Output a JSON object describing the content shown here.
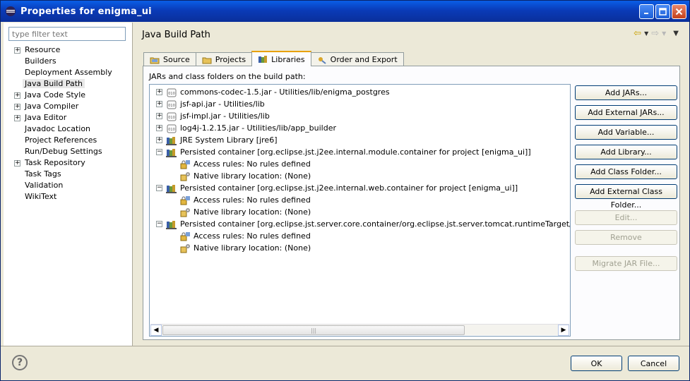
{
  "window": {
    "title": "Properties for enigma_ui"
  },
  "filter": {
    "placeholder": "type filter text"
  },
  "nav": {
    "items": [
      {
        "label": "Resource",
        "expandable": true
      },
      {
        "label": "Builders",
        "expandable": false
      },
      {
        "label": "Deployment Assembly",
        "expandable": false
      },
      {
        "label": "Java Build Path",
        "expandable": false,
        "selected": true
      },
      {
        "label": "Java Code Style",
        "expandable": true
      },
      {
        "label": "Java Compiler",
        "expandable": true
      },
      {
        "label": "Java Editor",
        "expandable": true
      },
      {
        "label": "Javadoc Location",
        "expandable": false
      },
      {
        "label": "Project References",
        "expandable": false
      },
      {
        "label": "Run/Debug Settings",
        "expandable": false
      },
      {
        "label": "Task Repository",
        "expandable": true
      },
      {
        "label": "Task Tags",
        "expandable": false
      },
      {
        "label": "Validation",
        "expandable": false
      },
      {
        "label": "WikiText",
        "expandable": false
      }
    ]
  },
  "main": {
    "title": "Java Build Path",
    "tabs": [
      {
        "label": "Source"
      },
      {
        "label": "Projects"
      },
      {
        "label": "Libraries",
        "active": true
      },
      {
        "label": "Order and Export"
      }
    ],
    "caption": "JARs and class folders on the build path:",
    "tree": [
      {
        "label": "commons-codec-1.5.jar - Utilities/lib/enigma_postgres",
        "level": 0,
        "exp": "+",
        "icon": "jar"
      },
      {
        "label": "jsf-api.jar - Utilities/lib",
        "level": 0,
        "exp": "+",
        "icon": "jar"
      },
      {
        "label": "jsf-impl.jar - Utilities/lib",
        "level": 0,
        "exp": "+",
        "icon": "jar"
      },
      {
        "label": "log4j-1.2.15.jar - Utilities/lib/app_builder",
        "level": 0,
        "exp": "+",
        "icon": "jar"
      },
      {
        "label": "JRE System Library [jre6]",
        "level": 0,
        "exp": "+",
        "icon": "library"
      },
      {
        "label": "Persisted container [org.eclipse.jst.j2ee.internal.module.container for project [enigma_ui]]",
        "level": 0,
        "exp": "-",
        "icon": "library"
      },
      {
        "label": "Access rules: No rules defined",
        "level": 1,
        "icon": "access"
      },
      {
        "label": "Native library location: (None)",
        "level": 1,
        "icon": "native"
      },
      {
        "label": "Persisted container [org.eclipse.jst.j2ee.internal.web.container for project [enigma_ui]]",
        "level": 0,
        "exp": "-",
        "icon": "library"
      },
      {
        "label": "Access rules: No rules defined",
        "level": 1,
        "icon": "access"
      },
      {
        "label": "Native library location: (None)",
        "level": 1,
        "icon": "native"
      },
      {
        "label": "Persisted container [org.eclipse.jst.server.core.container/org.eclipse.jst.server.tomcat.runtimeTarget/Apache Tor",
        "level": 0,
        "exp": "-",
        "icon": "library"
      },
      {
        "label": "Access rules: No rules defined",
        "level": 1,
        "icon": "access"
      },
      {
        "label": "Native library location: (None)",
        "level": 1,
        "icon": "native"
      }
    ],
    "buttons": [
      {
        "label": "Add JARs...",
        "enabled": true
      },
      {
        "label": "Add External JARs...",
        "enabled": true
      },
      {
        "label": "Add Variable...",
        "enabled": true
      },
      {
        "label": "Add Library...",
        "enabled": true
      },
      {
        "label": "Add Class Folder...",
        "enabled": true
      },
      {
        "label": "Add External Class Folder...",
        "enabled": true
      },
      {
        "label": "Edit...",
        "enabled": false
      },
      {
        "label": "Remove",
        "enabled": false
      },
      {
        "label": "Migrate JAR File...",
        "enabled": false
      }
    ]
  },
  "footer": {
    "ok": "OK",
    "cancel": "Cancel",
    "help": "?"
  }
}
